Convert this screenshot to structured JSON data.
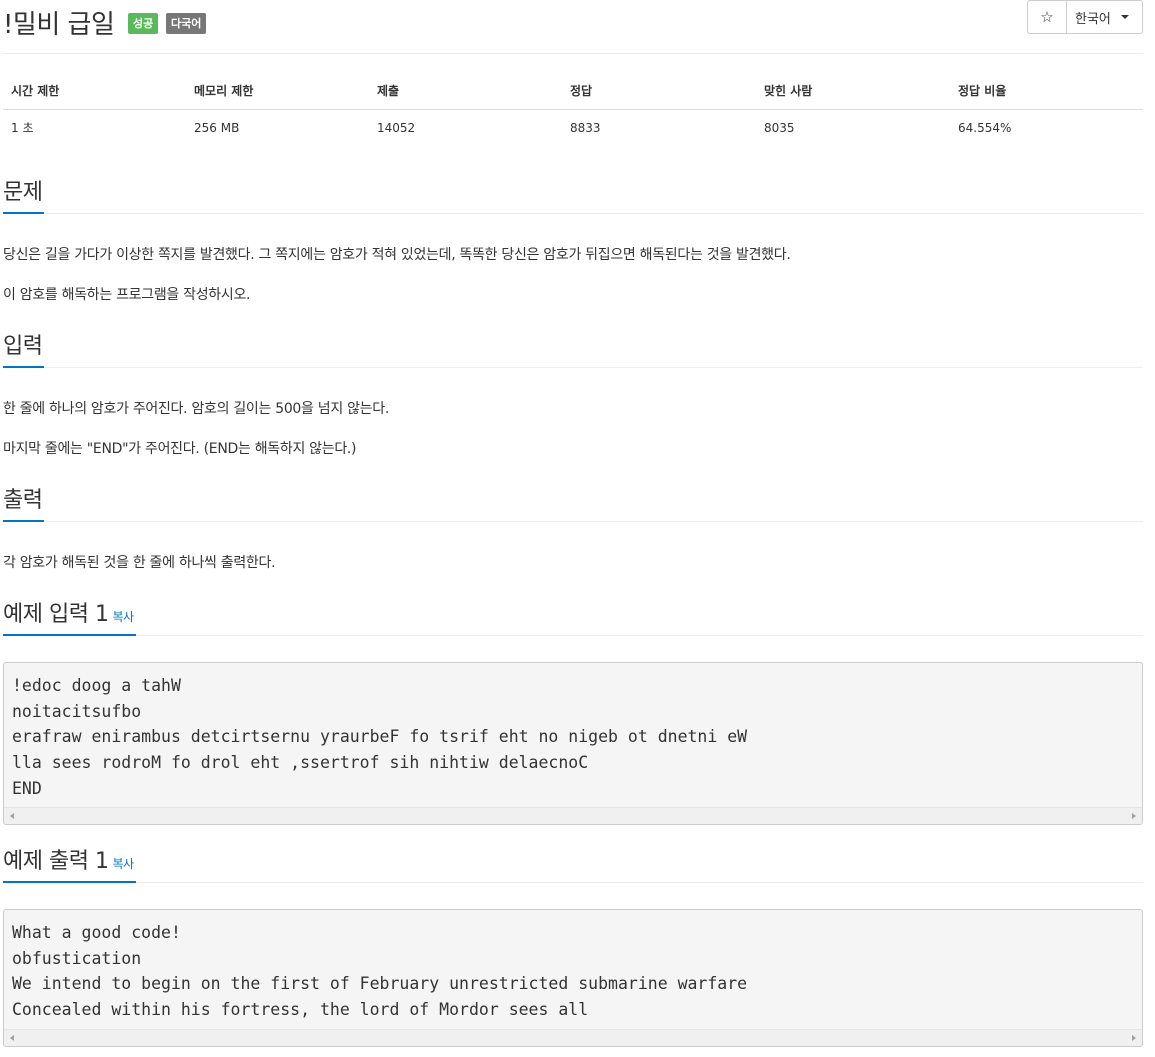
{
  "header": {
    "title": "!밀비 급일",
    "badges": {
      "success": "성공",
      "multilang": "다국어"
    },
    "star_icon": "☆",
    "language_button": "한국어"
  },
  "info": {
    "headers": [
      "시간 제한",
      "메모리 제한",
      "제출",
      "정답",
      "맞힌 사람",
      "정답 비율"
    ],
    "values": [
      "1 초",
      "256 MB",
      "14052",
      "8833",
      "8035",
      "64.554%"
    ]
  },
  "sections": {
    "problem": {
      "title": "문제",
      "paragraphs": [
        "당신은 길을 가다가 이상한 쪽지를 발견했다. 그 쪽지에는 암호가 적혀 있었는데, 똑똑한 당신은 암호가 뒤집으면 해독된다는 것을 발견했다.",
        "이 암호를 해독하는 프로그램을 작성하시오."
      ]
    },
    "input": {
      "title": "입력",
      "paragraphs": [
        "한 줄에 하나의 암호가 주어진다. 암호의 길이는 500을 넘지 않는다.",
        "마지막 줄에는 \"END\"가 주어진다. (END는 해독하지 않는다.)"
      ]
    },
    "output": {
      "title": "출력",
      "paragraphs": [
        "각 암호가 해독된 것을 한 줄에 하나씩 출력한다."
      ]
    },
    "sample_input": {
      "title": "예제 입력 1",
      "copy": "복사",
      "content": "!edoc doog a tahW\nnoitacitsufbo\nerafraw enirambus detcirtsernu yraurbeF fo tsrif eht no nigeb ot dnetni eW\nlla sees rodroM fo drol eht ,ssertrof sih nihtiw delaecnoC\nEND"
    },
    "sample_output": {
      "title": "예제 출력 1",
      "copy": "복사",
      "content": "What a good code!\nobfustication\nWe intend to begin on the first of February unrestricted submarine warfare\nConcealed within his fortress, the lord of Mordor sees all"
    }
  },
  "colors": {
    "accent": "#0076c0",
    "success": "#5cb85c",
    "badge_gray": "#777777"
  }
}
